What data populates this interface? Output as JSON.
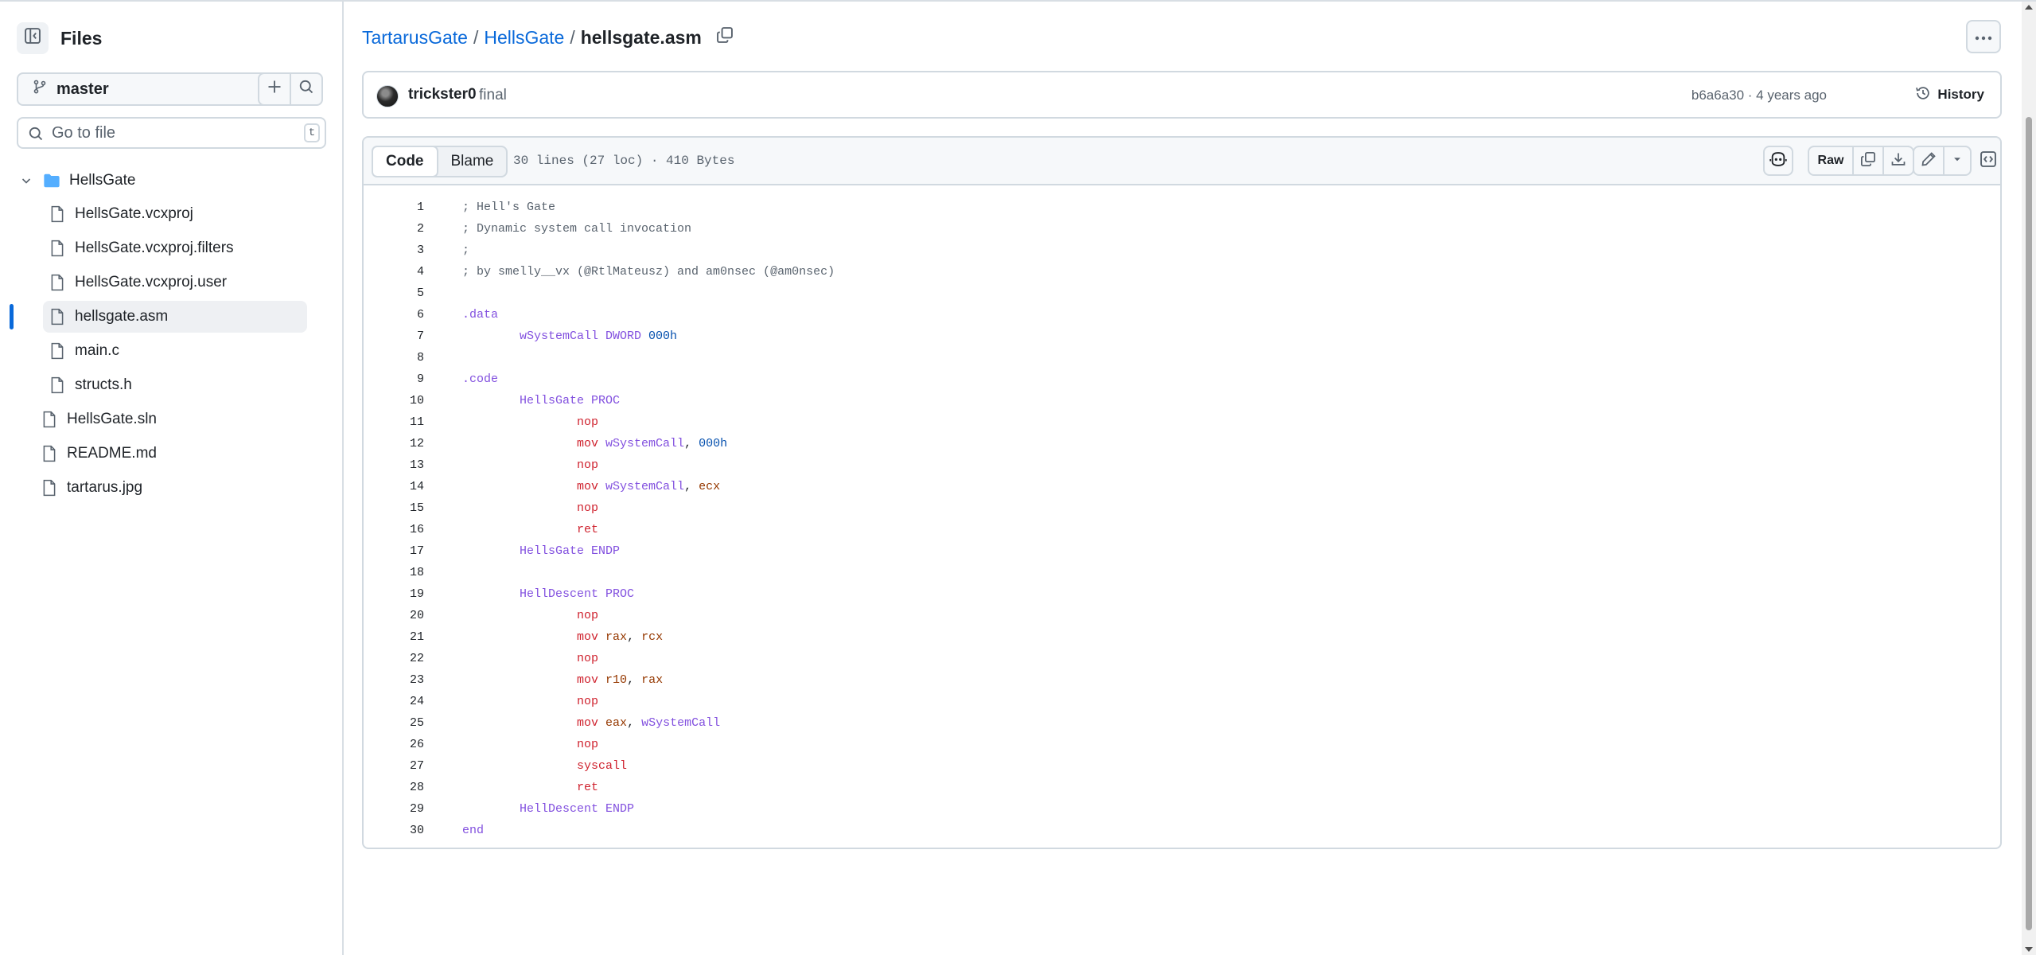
{
  "sidebar": {
    "title": "Files",
    "branch": "master",
    "goto_placeholder": "Go to file",
    "goto_shortcut": "t",
    "tree": [
      {
        "label": "HellsGate",
        "type": "folder",
        "depth": 0,
        "expanded": true
      },
      {
        "label": "HellsGate.vcxproj",
        "type": "file",
        "depth": 1
      },
      {
        "label": "HellsGate.vcxproj.filters",
        "type": "file",
        "depth": 1
      },
      {
        "label": "HellsGate.vcxproj.user",
        "type": "file",
        "depth": 1
      },
      {
        "label": "hellsgate.asm",
        "type": "file",
        "depth": 1,
        "selected": true
      },
      {
        "label": "main.c",
        "type": "file",
        "depth": 1
      },
      {
        "label": "structs.h",
        "type": "file",
        "depth": 1
      },
      {
        "label": "HellsGate.sln",
        "type": "file",
        "depth": 0
      },
      {
        "label": "README.md",
        "type": "file",
        "depth": 0
      },
      {
        "label": "tartarus.jpg",
        "type": "file",
        "depth": 0
      }
    ]
  },
  "breadcrumb": {
    "repo": "TartarusGate",
    "folder": "HellsGate",
    "file": "hellsgate.asm",
    "separator": "/"
  },
  "commit": {
    "author": "trickster0",
    "message": "final",
    "hash_age": "b6a6a30 · 4 years ago",
    "history_label": "History"
  },
  "file_view": {
    "tab_code": "Code",
    "tab_blame": "Blame",
    "meta": "30 lines (27 loc) · 410 Bytes",
    "raw_label": "Raw"
  },
  "code_lines": [
    {
      "n": "1",
      "t": [
        [
          "c-com",
          "; Hell's Gate"
        ]
      ]
    },
    {
      "n": "2",
      "t": [
        [
          "c-com",
          "; Dynamic system call invocation"
        ]
      ]
    },
    {
      "n": "3",
      "t": [
        [
          "c-com",
          ";"
        ]
      ]
    },
    {
      "n": "4",
      "t": [
        [
          "c-com",
          "; by smelly__vx (@RtlMateusz) and am0nsec (@am0nsec)"
        ]
      ]
    },
    {
      "n": "5",
      "t": []
    },
    {
      "n": "6",
      "t": [
        [
          "c-kw",
          ".data"
        ]
      ]
    },
    {
      "n": "7",
      "t": [
        [
          "",
          "        "
        ],
        [
          "c-kw",
          "wSystemCall DWORD "
        ],
        [
          "c-num",
          "000h"
        ]
      ]
    },
    {
      "n": "8",
      "t": []
    },
    {
      "n": "9",
      "t": [
        [
          "c-kw",
          ".code"
        ]
      ]
    },
    {
      "n": "10",
      "t": [
        [
          "",
          "        "
        ],
        [
          "c-kw",
          "HellsGate PROC"
        ]
      ]
    },
    {
      "n": "11",
      "t": [
        [
          "",
          "                "
        ],
        [
          "c-op",
          "nop"
        ]
      ]
    },
    {
      "n": "12",
      "t": [
        [
          "",
          "                "
        ],
        [
          "c-op",
          "mov "
        ],
        [
          "c-kw",
          "wSystemCall"
        ],
        [
          "",
          ", "
        ],
        [
          "c-num",
          "000h"
        ]
      ]
    },
    {
      "n": "13",
      "t": [
        [
          "",
          "                "
        ],
        [
          "c-op",
          "nop"
        ]
      ]
    },
    {
      "n": "14",
      "t": [
        [
          "",
          "                "
        ],
        [
          "c-op",
          "mov "
        ],
        [
          "c-kw",
          "wSystemCall"
        ],
        [
          "",
          ", "
        ],
        [
          "c-reg",
          "ecx"
        ]
      ]
    },
    {
      "n": "15",
      "t": [
        [
          "",
          "                "
        ],
        [
          "c-op",
          "nop"
        ]
      ]
    },
    {
      "n": "16",
      "t": [
        [
          "",
          "                "
        ],
        [
          "c-op",
          "ret"
        ]
      ]
    },
    {
      "n": "17",
      "t": [
        [
          "",
          "        "
        ],
        [
          "c-kw",
          "HellsGate ENDP"
        ]
      ]
    },
    {
      "n": "18",
      "t": []
    },
    {
      "n": "19",
      "t": [
        [
          "",
          "        "
        ],
        [
          "c-kw",
          "HellDescent PROC"
        ]
      ]
    },
    {
      "n": "20",
      "t": [
        [
          "",
          "                "
        ],
        [
          "c-op",
          "nop"
        ]
      ]
    },
    {
      "n": "21",
      "t": [
        [
          "",
          "                "
        ],
        [
          "c-op",
          "mov "
        ],
        [
          "c-reg",
          "rax"
        ],
        [
          "",
          ", "
        ],
        [
          "c-reg",
          "rcx"
        ]
      ]
    },
    {
      "n": "22",
      "t": [
        [
          "",
          "                "
        ],
        [
          "c-op",
          "nop"
        ]
      ]
    },
    {
      "n": "23",
      "t": [
        [
          "",
          "                "
        ],
        [
          "c-op",
          "mov "
        ],
        [
          "c-reg",
          "r10"
        ],
        [
          "",
          ", "
        ],
        [
          "c-reg",
          "rax"
        ]
      ]
    },
    {
      "n": "24",
      "t": [
        [
          "",
          "                "
        ],
        [
          "c-op",
          "nop"
        ]
      ]
    },
    {
      "n": "25",
      "t": [
        [
          "",
          "                "
        ],
        [
          "c-op",
          "mov "
        ],
        [
          "c-reg",
          "eax"
        ],
        [
          "",
          ", "
        ],
        [
          "c-kw",
          "wSystemCall"
        ]
      ]
    },
    {
      "n": "26",
      "t": [
        [
          "",
          "                "
        ],
        [
          "c-op",
          "nop"
        ]
      ]
    },
    {
      "n": "27",
      "t": [
        [
          "",
          "                "
        ],
        [
          "c-op",
          "syscall"
        ]
      ]
    },
    {
      "n": "28",
      "t": [
        [
          "",
          "                "
        ],
        [
          "c-op",
          "ret"
        ]
      ]
    },
    {
      "n": "29",
      "t": [
        [
          "",
          "        "
        ],
        [
          "c-kw",
          "HellDescent ENDP"
        ]
      ]
    },
    {
      "n": "30",
      "t": [
        [
          "c-kw",
          "end"
        ]
      ]
    }
  ],
  "colors": {
    "accent": "#0969da",
    "border": "#d1d9e0",
    "muted": "#59636e",
    "folder": "#54aeff"
  },
  "icons": [
    "sidebar-collapse-icon",
    "branch-icon",
    "chevron-down-icon",
    "plus-icon",
    "search-icon",
    "folder-icon",
    "file-icon",
    "copy-icon",
    "kebab-icon",
    "history-icon",
    "copilot-icon",
    "download-icon",
    "pencil-icon",
    "symbols-icon"
  ]
}
